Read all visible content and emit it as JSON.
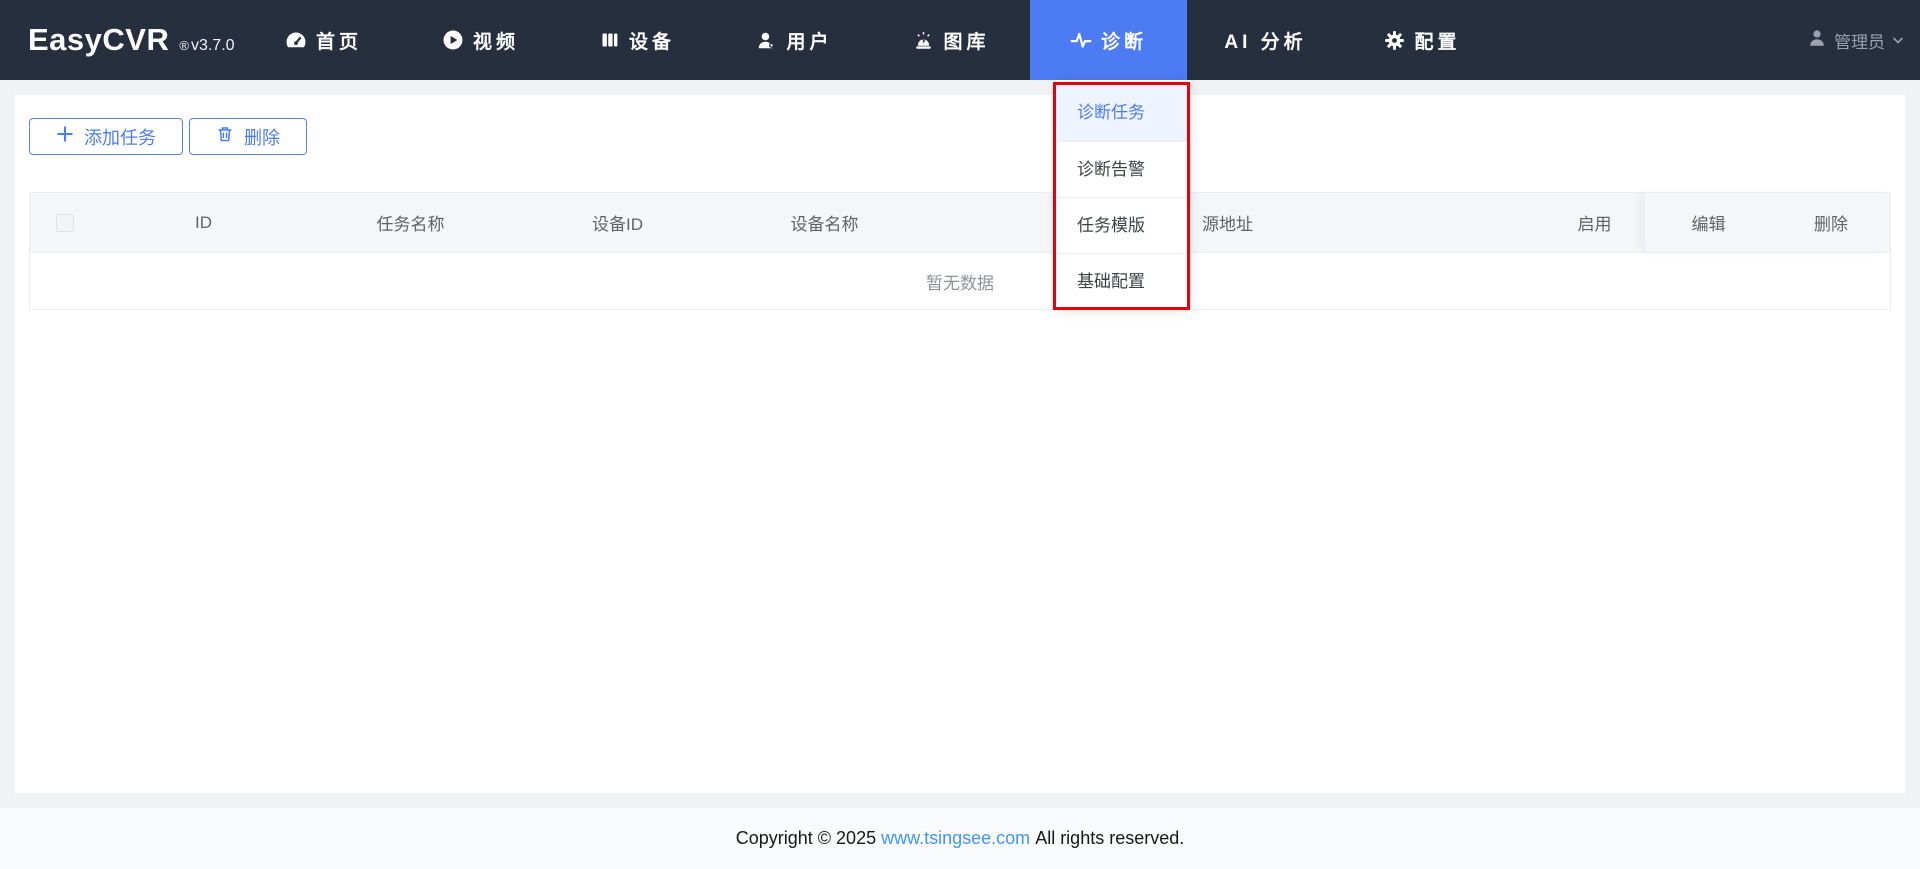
{
  "navbar": {
    "logo": "EasyCVR",
    "reg": "®",
    "version": "v3.7.0",
    "items": [
      {
        "label": "首页",
        "icon": "dashboard-icon",
        "active": false
      },
      {
        "label": "视频",
        "icon": "play-icon",
        "active": false
      },
      {
        "label": "设备",
        "icon": "device-icon",
        "active": false
      },
      {
        "label": "用户",
        "icon": "user-icon",
        "active": false
      },
      {
        "label": "图库",
        "icon": "alarm-icon",
        "active": false
      },
      {
        "label": "诊断",
        "icon": "pulse-icon",
        "active": true
      },
      {
        "label": "AI 分析",
        "icon": "none",
        "active": false
      },
      {
        "label": "配置",
        "icon": "gear-icon",
        "active": false
      }
    ],
    "user": {
      "name": "管理员"
    }
  },
  "dropdown": {
    "items": [
      {
        "label": "诊断任务",
        "active": true
      },
      {
        "label": "诊断告警",
        "active": false
      },
      {
        "label": "任务模版",
        "active": false
      },
      {
        "label": "基础配置",
        "active": false
      }
    ]
  },
  "toolbar": {
    "add_button": "添加任务",
    "delete_button": "删除"
  },
  "table": {
    "columns": [
      "ID",
      "任务名称",
      "设备ID",
      "设备名称",
      "",
      "源地址",
      "启用",
      "编辑",
      "删除"
    ],
    "empty_text": "暂无数据"
  },
  "footer": {
    "prefix": "Copyright © 2025 ",
    "link": "www.tsingsee.com",
    "suffix": " All rights reserved."
  },
  "colors": {
    "navbar_bg": "#262f3e",
    "accent_blue": "#4c7bf4",
    "annotation_red": "#e8000b",
    "link_blue": "#3e97f5",
    "header_bg": "#f5f6f8",
    "page_bg": "#f0f2f5"
  }
}
